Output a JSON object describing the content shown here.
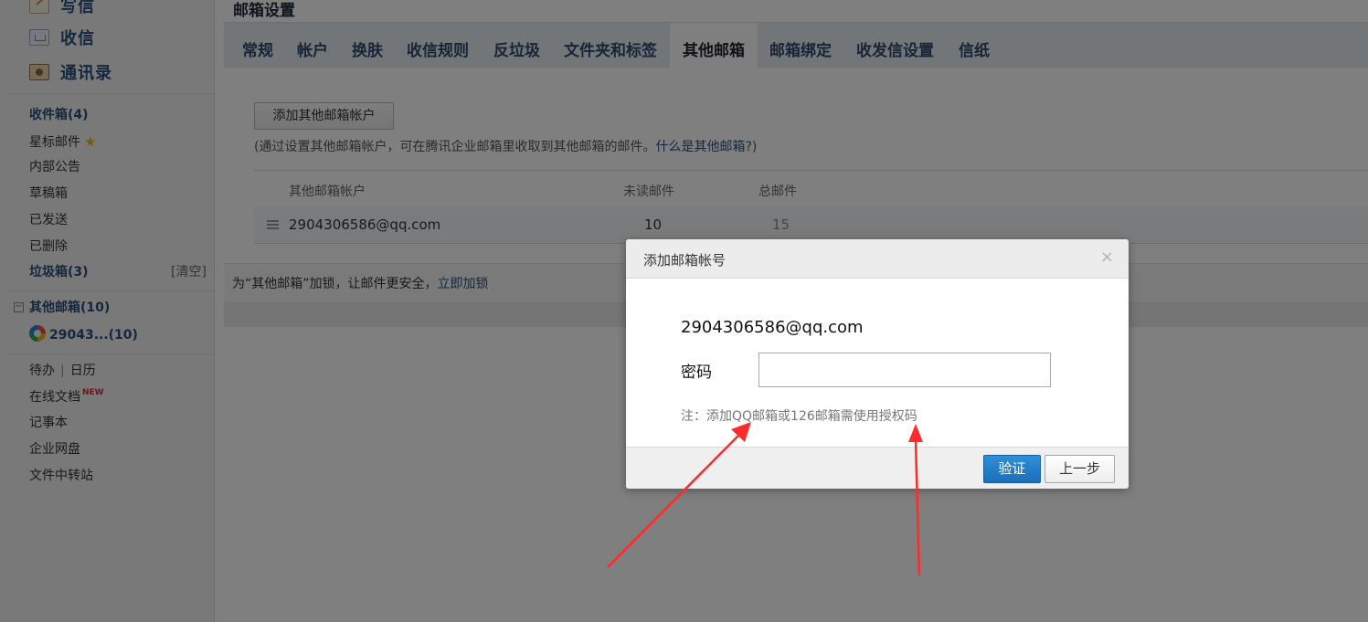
{
  "sidebar": {
    "quick_actions": [
      {
        "label": "写信",
        "icon": "write-icon"
      },
      {
        "label": "收信",
        "icon": "inbox-icon"
      },
      {
        "label": "通讯录",
        "icon": "contacts-icon"
      }
    ],
    "folders": {
      "inbox": "收件箱(4)",
      "starred": "星标邮件",
      "announcements": "内部公告",
      "drafts": "草稿箱",
      "sent": "已发送",
      "deleted": "已删除",
      "spam": "垃圾箱(3)",
      "clear": "[清空]"
    },
    "other_mail": {
      "header": "其他邮箱(10)",
      "account": "29043...(10)"
    },
    "tools": {
      "todo": "待办",
      "separator": "|",
      "calendar": "日历",
      "docs": "在线文档",
      "docs_badge": "NEW",
      "notebook": "记事本",
      "netdisk": "企业网盘",
      "transfer": "文件中转站"
    }
  },
  "main": {
    "page_title": "邮箱设置",
    "tabs": [
      "常规",
      "帐户",
      "换肤",
      "收信规则",
      "反垃圾",
      "文件夹和标签",
      "其他邮箱",
      "邮箱绑定",
      "收发信设置",
      "信纸"
    ],
    "active_tab": "其他邮箱",
    "add_button": "添加其他邮箱帐户",
    "hint": {
      "text": "(通过设置其他邮箱帐户，可在腾讯企业邮箱里收取到其他邮箱的邮件。",
      "link": "什么是其他邮箱?",
      "suffix": ")"
    },
    "table": {
      "headers": {
        "account": "其他邮箱帐户",
        "unread": "未读邮件",
        "total": "总邮件"
      },
      "rows": [
        {
          "account": "2904306586@qq.com",
          "unread": "10",
          "total": "15"
        }
      ]
    },
    "lock_notice": {
      "text": "为“其他邮箱”加锁，让邮件更安全，",
      "link": "立即加锁"
    }
  },
  "dialog": {
    "title": "添加邮箱帐号",
    "close": "×",
    "email": "2904306586@qq.com",
    "password_label": "密码",
    "password_value": "",
    "note": "注：添加QQ邮箱或126邮箱需使用授权码",
    "verify_button": "验证",
    "prev_button": "上一步"
  },
  "colors": {
    "overlay": "#000000",
    "annotation_arrow": "#ff2a2a",
    "primary_button": "#2183cf",
    "tab_bar": "#e6ecf3"
  }
}
